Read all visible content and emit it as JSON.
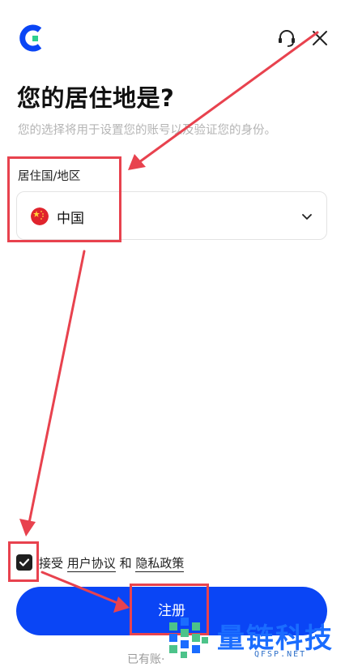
{
  "header": {
    "logo_icon": "brand-c-logo",
    "support_icon": "headset-icon",
    "close_icon": "close-icon"
  },
  "page": {
    "title": "您的居住地是?",
    "subtitle": "您的选择将用于设置您的账号以及验证您的身份。"
  },
  "residence": {
    "label": "居住国/地区",
    "selected_value": "中国",
    "flag_icon": "china-flag-icon"
  },
  "agreement": {
    "checked": true,
    "prefix": "接受",
    "terms_link": "用户协议",
    "and": "和",
    "privacy_link": "隐私政策"
  },
  "actions": {
    "register_label": "注册",
    "login_hint": "已有账·"
  },
  "watermark": {
    "name": "量链科技",
    "domain": "QFSP.NET"
  },
  "colors": {
    "primary": "#0a45f5",
    "annotation": "#e8424e",
    "brand_accent": "#2ecf8f"
  }
}
